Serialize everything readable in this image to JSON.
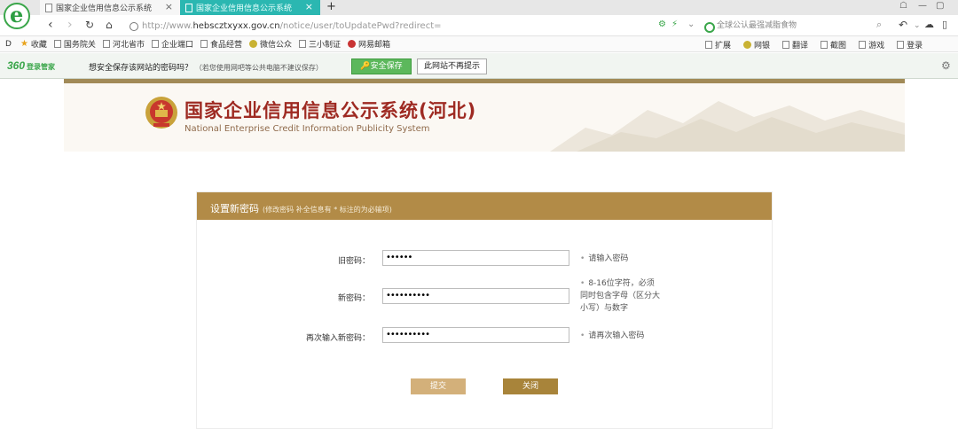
{
  "browser": {
    "logo_letter": "e",
    "tabs": [
      {
        "label": "国家企业信用信息公示系统"
      },
      {
        "label": "国家企业信用信息公示系统"
      }
    ],
    "new_tab_symbol": "+",
    "address": {
      "url_prefix": "http://www.",
      "url_host": "hebscztxyxx.gov.cn",
      "url_path": "/notice/user/toUpdatePwd?redirect="
    },
    "search_placeholder": "全球公认最强减脂食物"
  },
  "bookmarks": {
    "left_label": "D",
    "items": [
      {
        "label": "收藏",
        "icon": "star-icon"
      },
      {
        "label": "国务院关",
        "icon": "page-icon"
      },
      {
        "label": "河北省市",
        "icon": "page-icon"
      },
      {
        "label": "企业端口",
        "icon": "page-icon"
      },
      {
        "label": "食品经营",
        "icon": "page-icon"
      },
      {
        "label": "微信公众",
        "icon": "globe-icon"
      },
      {
        "label": "三小制证",
        "icon": "page-icon"
      },
      {
        "label": "网易邮箱",
        "icon": "mail-icon"
      }
    ],
    "right_items": [
      {
        "label": "扩展"
      },
      {
        "label": "网银"
      },
      {
        "label": "翻译"
      },
      {
        "label": "截图"
      },
      {
        "label": "游戏"
      },
      {
        "label": "登录"
      }
    ]
  },
  "password_bar": {
    "brand": "360",
    "brand_sub": "登录管家",
    "question": "想安全保存该网站的密码吗？",
    "question_note": "（若您使用网吧等公共电脑不建议保存）",
    "save_button": "安全保存",
    "never_button": "此网站不再提示"
  },
  "site": {
    "title": "国家企业信用信息公示系统(河北)",
    "subtitle": "National Enterprise Credit Information Publicity System"
  },
  "form": {
    "heading": "设置新密码",
    "heading_note": "(修改密码 补全信息有 * 标注的为必输项)",
    "fields": [
      {
        "label": "旧密码：",
        "value": "••••••",
        "hint_lines": [
          "请输入密码"
        ]
      },
      {
        "label": "新密码：",
        "value": "••••••••••",
        "hint_lines": [
          "8-16位字符，必须",
          "同时包含字母（区分大",
          "小写）与数字"
        ]
      },
      {
        "label": "再次输入新密码：",
        "value": "••••••••••",
        "hint_lines": [
          "请再次输入密码"
        ]
      }
    ],
    "submit_label": "提交",
    "close_label": "关闭"
  },
  "colors": {
    "tab_active": "#2bb7b1",
    "panel_header": "#b28b47",
    "title_red": "#9e2a22",
    "save_green": "#5cb85c"
  }
}
